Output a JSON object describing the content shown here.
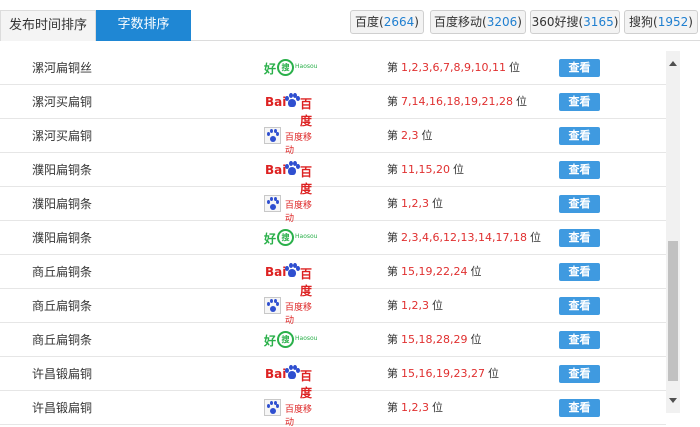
{
  "sort_tabs": [
    {
      "label": "发布时间排序",
      "active": false
    },
    {
      "label": "字数排序",
      "active": true
    }
  ],
  "engine_tabs": [
    {
      "name": "百度",
      "count": "2664"
    },
    {
      "name": "百度移动",
      "count": "3206"
    },
    {
      "name": "360好搜",
      "count": "3165"
    },
    {
      "name": "搜狗",
      "count": "1952"
    }
  ],
  "logos": {
    "haosou": {
      "main": "好",
      "circle": "搜",
      "sub": "Haosou"
    },
    "baidu": {
      "bai": "Bai",
      "du": "百度"
    },
    "baidu_mobile": {
      "text": "百度移动"
    }
  },
  "rank_prefix": "第",
  "rank_suffix": "位",
  "view_label": "查看",
  "rows": [
    {
      "keyword": "漯河扁铜丝",
      "engine": "haosou",
      "positions": "1,2,3,6,7,8,9,10,11"
    },
    {
      "keyword": "漯河买扁铜",
      "engine": "baidu",
      "positions": "7,14,16,18,19,21,28"
    },
    {
      "keyword": "漯河买扁铜",
      "engine": "baidu_mobile",
      "positions": "2,3"
    },
    {
      "keyword": "濮阳扁铜条",
      "engine": "baidu",
      "positions": "11,15,20"
    },
    {
      "keyword": "濮阳扁铜条",
      "engine": "baidu_mobile",
      "positions": "1,2,3"
    },
    {
      "keyword": "濮阳扁铜条",
      "engine": "haosou",
      "positions": "2,3,4,6,12,13,14,17,18"
    },
    {
      "keyword": "商丘扁铜条",
      "engine": "baidu",
      "positions": "15,19,22,24"
    },
    {
      "keyword": "商丘扁铜条",
      "engine": "baidu_mobile",
      "positions": "1,2,3"
    },
    {
      "keyword": "商丘扁铜条",
      "engine": "haosou",
      "positions": "15,18,28,29"
    },
    {
      "keyword": "许昌锻扁铜",
      "engine": "baidu",
      "positions": "15,16,19,23,27"
    },
    {
      "keyword": "许昌锻扁铜",
      "engine": "baidu_mobile",
      "positions": "1,2,3"
    }
  ]
}
